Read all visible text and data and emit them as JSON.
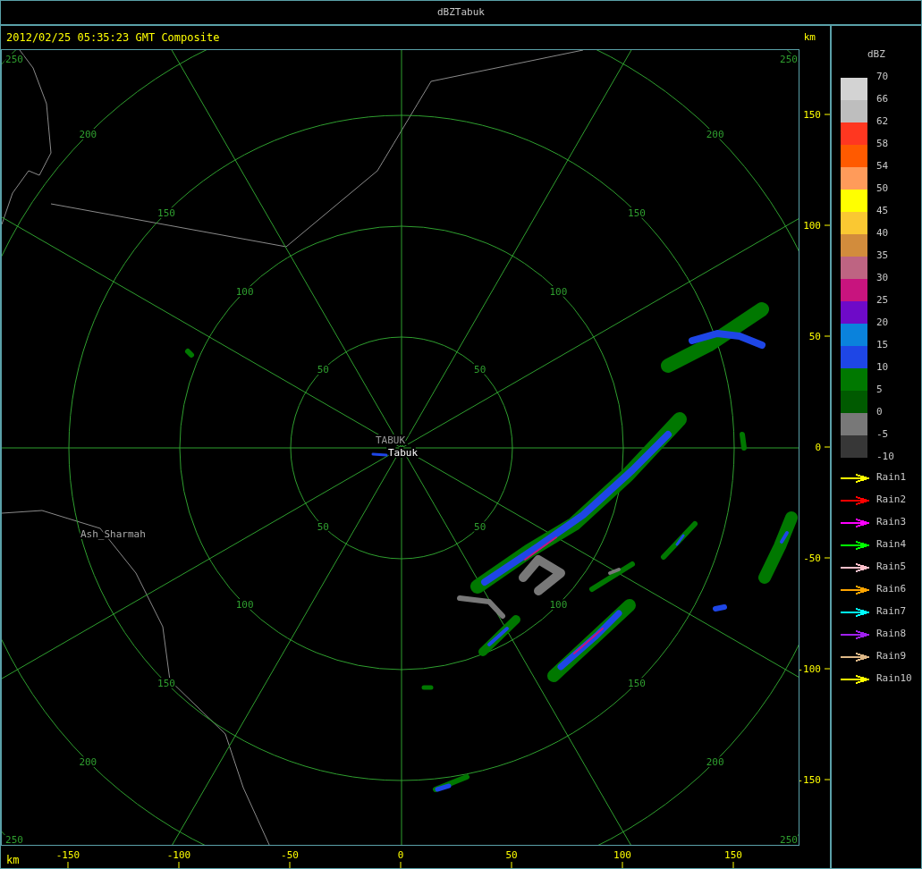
{
  "window": {
    "title": "dBZTabuk"
  },
  "header": {
    "timestamp": "2012/02/25 05:35:23 GMT Composite",
    "unit": "km"
  },
  "radar": {
    "station_labels": [
      "TABUK",
      "Tabuk"
    ],
    "places": [
      "Ash_Sharmah"
    ],
    "rings": [
      {
        "labels": [
          "50",
          "50",
          "50",
          "50"
        ]
      },
      {
        "labels": [
          "100",
          "100",
          "100",
          "100"
        ]
      },
      {
        "labels": [
          "150",
          "150",
          "150",
          "150"
        ]
      },
      {
        "labels": [
          "200",
          "200",
          "200",
          "200"
        ]
      },
      {
        "labels": [
          "250",
          "250",
          "250",
          "250"
        ]
      }
    ]
  },
  "y_axis": {
    "ticks": [
      "150",
      "100",
      "50",
      "0",
      "-50",
      "-100",
      "-150"
    ]
  },
  "x_axis": {
    "unit": "km",
    "ticks": [
      "-150",
      "-100",
      "-50",
      "0",
      "50",
      "100",
      "150"
    ]
  },
  "legend": {
    "title": "dBZ",
    "scale_labels": [
      "70",
      "66",
      "62",
      "58",
      "54",
      "50",
      "45",
      "40",
      "35",
      "30",
      "25",
      "20",
      "15",
      "10",
      "5",
      "0",
      "-5",
      "-10"
    ],
    "bins": [
      {
        "color": "#d3d3d3"
      },
      {
        "color": "#bebebe"
      },
      {
        "color": "#ff3720"
      },
      {
        "color": "#ff5a00"
      },
      {
        "color": "#ff9b5a"
      },
      {
        "color": "#ffff00"
      },
      {
        "color": "#fac832"
      },
      {
        "color": "#d28c3c"
      },
      {
        "color": "#be6482"
      },
      {
        "color": "#c8147e"
      },
      {
        "color": "#6e0ac8"
      },
      {
        "color": "#0a82dc"
      },
      {
        "color": "#1e46e6"
      },
      {
        "color": "#007800"
      },
      {
        "color": "#005a00"
      },
      {
        "color": "#787878"
      },
      {
        "color": "#373737"
      }
    ],
    "tracks": [
      {
        "label": "Rain1",
        "color": "#ffff00"
      },
      {
        "label": "Rain2",
        "color": "#ff0000"
      },
      {
        "label": "Rain3",
        "color": "#ff00ff"
      },
      {
        "label": "Rain4",
        "color": "#00ff00"
      },
      {
        "label": "Rain5",
        "color": "#ffc0cb"
      },
      {
        "label": "Rain6",
        "color": "#ffa500"
      },
      {
        "label": "Rain7",
        "color": "#00ffff"
      },
      {
        "label": "Rain8",
        "color": "#a020f0"
      },
      {
        "label": "Rain9",
        "color": "#deb887"
      },
      {
        "label": "Rain10",
        "color": "#ffff00"
      }
    ]
  }
}
